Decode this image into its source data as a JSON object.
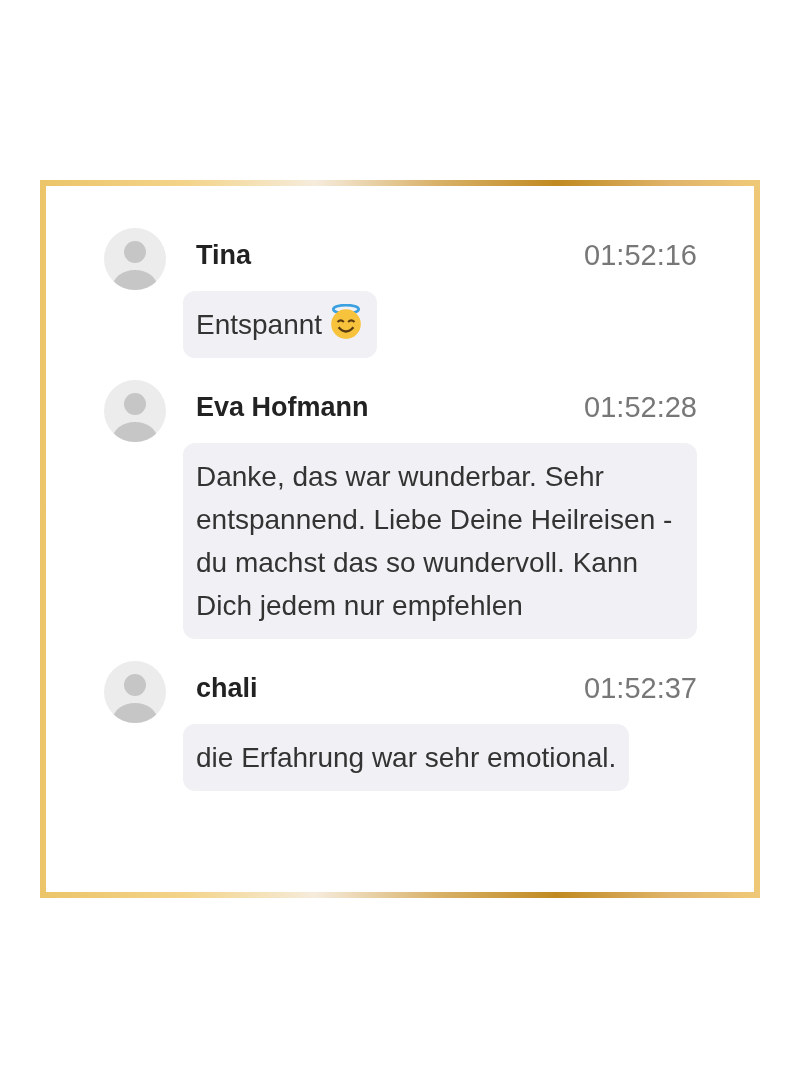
{
  "messages": [
    {
      "author": "Tina",
      "time": "01:52:16",
      "text": "Entspannt",
      "kind": "with-halo-face"
    },
    {
      "author": "Eva Hofmann",
      "time": "01:52:28",
      "text": "Danke, das war wunderbar. Sehr entspannend. Liebe Deine Heilreisen - du machst das so wundervoll. Kann Dich jedem nur empfehlen"
    },
    {
      "author": "chali",
      "time": "01:52:37",
      "text": "die Erfahrung war sehr emotional."
    }
  ]
}
